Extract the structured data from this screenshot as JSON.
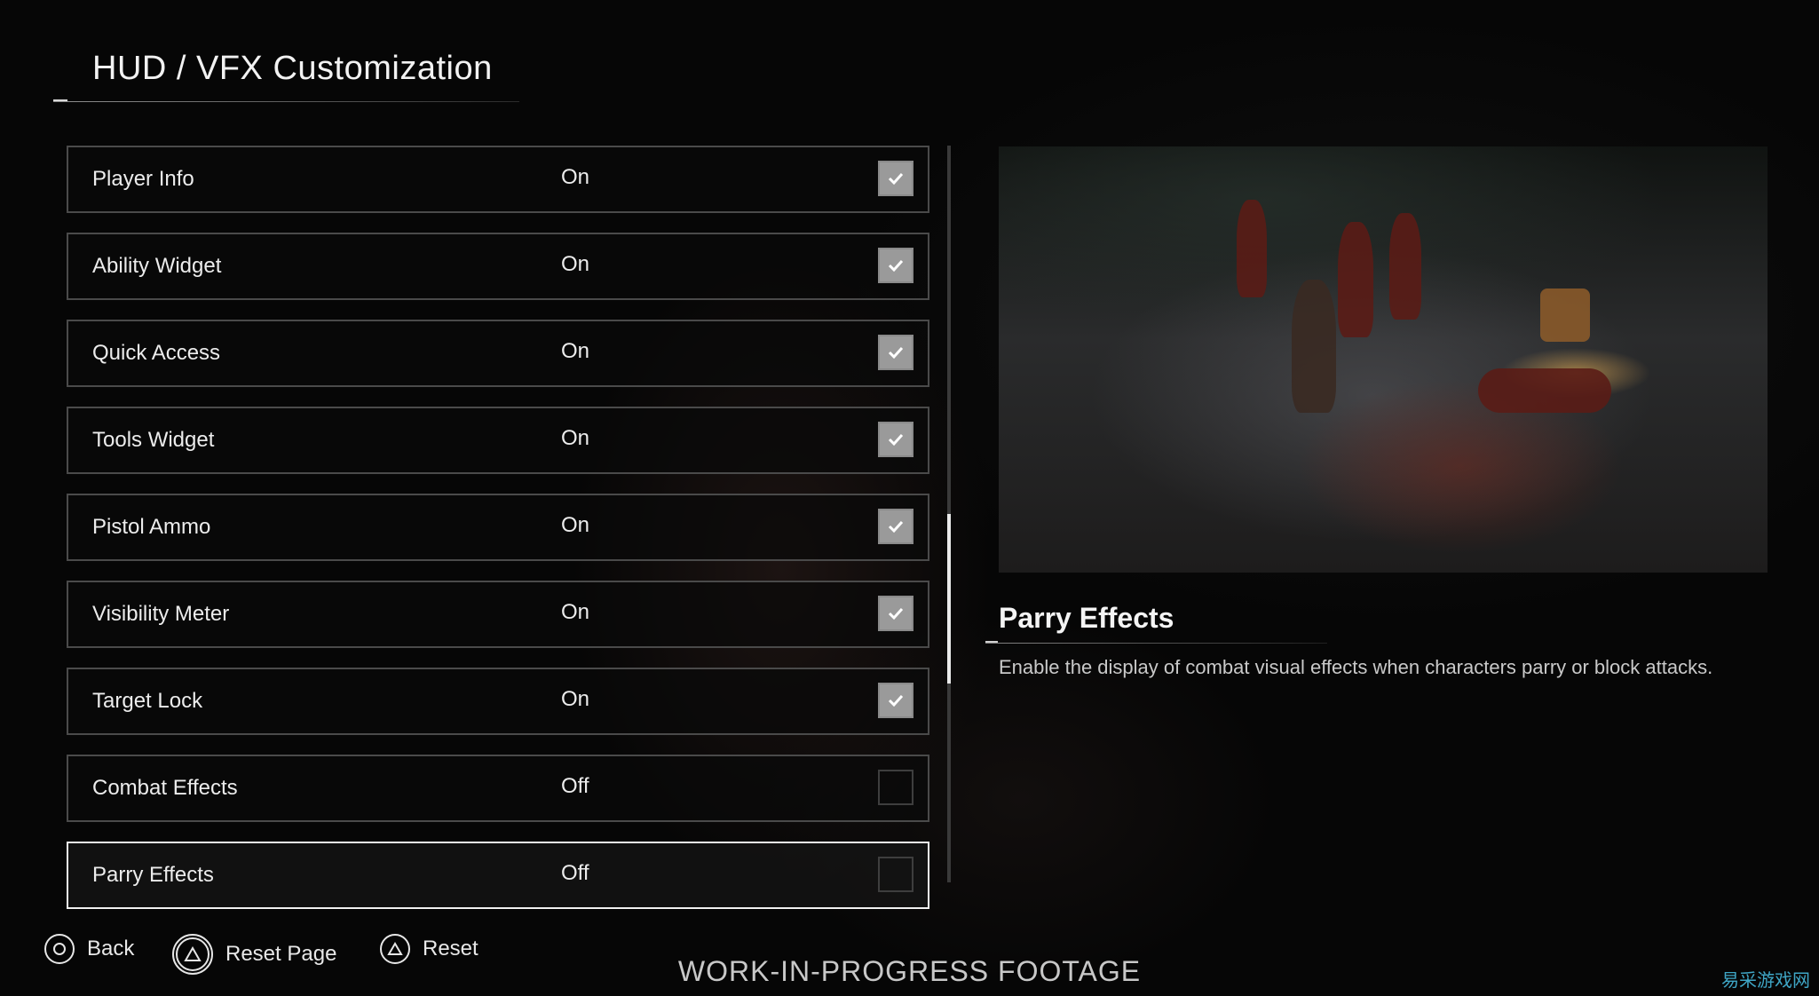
{
  "header": {
    "title": "HUD / VFX Customization"
  },
  "settings": [
    {
      "label": "Player Info",
      "value": "On",
      "checked": true
    },
    {
      "label": "Ability Widget",
      "value": "On",
      "checked": true
    },
    {
      "label": "Quick Access",
      "value": "On",
      "checked": true
    },
    {
      "label": "Tools Widget",
      "value": "On",
      "checked": true
    },
    {
      "label": "Pistol Ammo",
      "value": "On",
      "checked": true
    },
    {
      "label": "Visibility Meter",
      "value": "On",
      "checked": true
    },
    {
      "label": "Target Lock",
      "value": "On",
      "checked": true
    },
    {
      "label": "Combat Effects",
      "value": "Off",
      "checked": false
    },
    {
      "label": "Parry Effects",
      "value": "Off",
      "checked": false,
      "selected": true
    }
  ],
  "scroll": {
    "position_fraction": 0.65,
    "visible_fraction": 0.23
  },
  "info_panel": {
    "title": "Parry Effects",
    "description": "Enable the display of combat visual effects when characters parry or block attacks."
  },
  "footer": {
    "back_label": "Back",
    "reset_page_label": "Reset Page",
    "reset_label": "Reset",
    "back_icon": "circle-button-icon",
    "reset_page_icon": "triangle-button-icon",
    "reset_icon": "triangle-button-icon"
  },
  "watermark": "WORK-IN-PROGRESS FOOTAGE",
  "corner_mark": "易采游戏网",
  "colors": {
    "background": "#050505",
    "text": "#ececec",
    "row_border": "#4a4a4a",
    "selected_border": "#f0f0f0",
    "checkbox_on": "#9a9a9a",
    "corner_mark": "#3fa6c6"
  }
}
